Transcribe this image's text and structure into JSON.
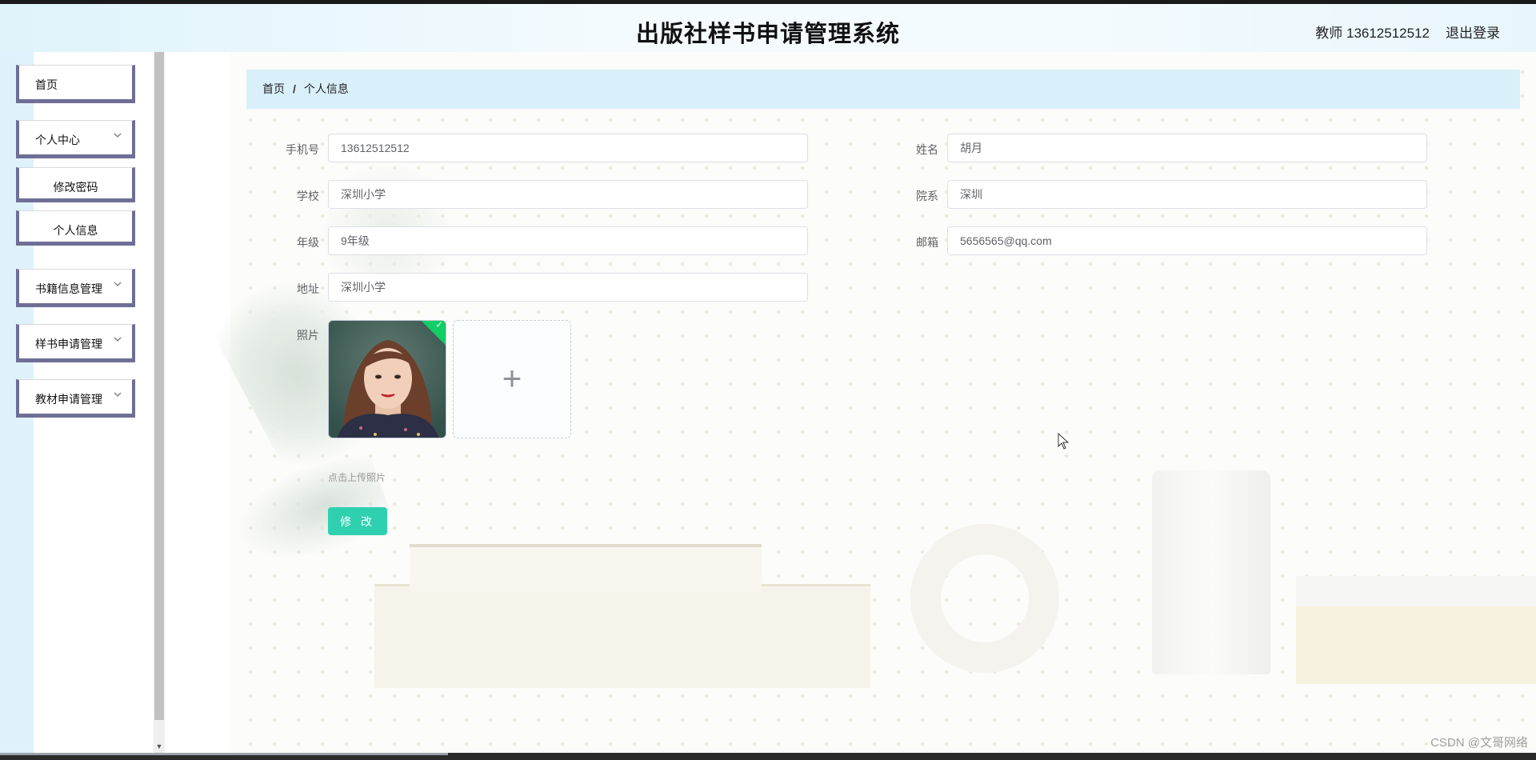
{
  "header": {
    "title": "出版社样书申请管理系统",
    "user": "教师 13612512512",
    "logout": "退出登录"
  },
  "sidebar": {
    "items": [
      {
        "label": "首页"
      },
      {
        "label": "个人中心",
        "chevron": "chevron-down-icon"
      },
      {
        "label": "修改密码"
      },
      {
        "label": "个人信息"
      },
      {
        "label": "书籍信息管理",
        "chevron": "chevron-down-icon"
      },
      {
        "label": "样书申请管理",
        "chevron": "chevron-down-icon"
      },
      {
        "label": "教材申请管理",
        "chevron": "chevron-down-icon"
      }
    ]
  },
  "breadcrumb": {
    "home": "首页",
    "separator": "/",
    "current": "个人信息"
  },
  "form": {
    "phone": {
      "label": "手机号",
      "value": "13612512512"
    },
    "name": {
      "label": "姓名",
      "value": "胡月"
    },
    "school": {
      "label": "学校",
      "value": "深圳小学"
    },
    "department": {
      "label": "院系",
      "value": "深圳"
    },
    "grade": {
      "label": "年级",
      "value": "9年级"
    },
    "email": {
      "label": "邮箱",
      "value": "5656565@qq.com"
    },
    "address": {
      "label": "地址",
      "value": "深圳小学"
    },
    "photo": {
      "label": "照片",
      "upload_tip": "点击上传照片",
      "upload_icon": "plus-icon"
    },
    "submit_label": "修 改"
  },
  "watermark": "CSDN @文哥网络",
  "colors": {
    "accent": "#2ed0b0",
    "breadcrumb_bg": "#d9f0fb",
    "menu_border": "#6e6e96",
    "success": "#13ce66"
  }
}
